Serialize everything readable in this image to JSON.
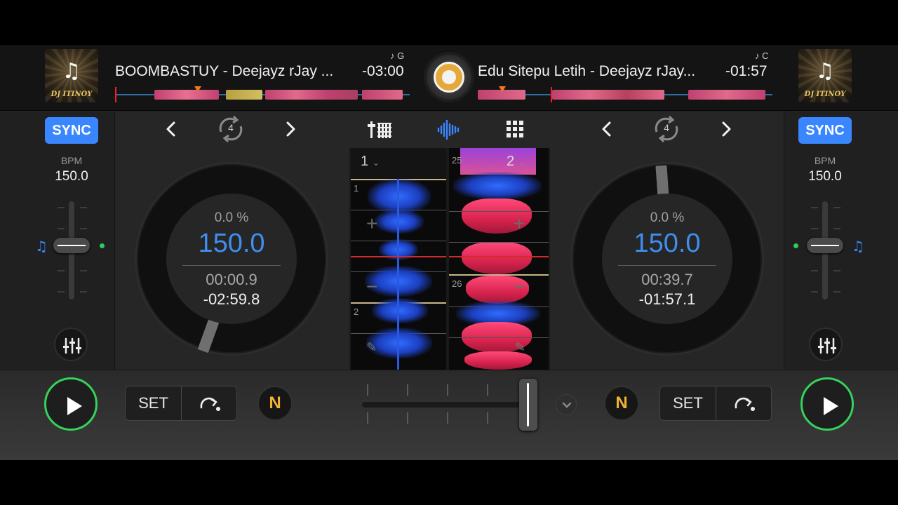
{
  "deck_a": {
    "title": "BOOMBASTUY - Deejayz rJay ...",
    "time_remaining": "-03:00",
    "key": "♪ G",
    "art_text": "DJ ITINOY",
    "sync_label": "SYNC",
    "bpm_label": "BPM",
    "bpm_value": "150.0",
    "loop_size": "4",
    "pitch_percent": "0.0 %",
    "bpm_big": "150.0",
    "elapsed": "00:00.9",
    "remaining": "-02:59.8",
    "set_label": "SET"
  },
  "deck_b": {
    "title": "Edu Sitepu Letih - Deejayz rJay...",
    "time_remaining": "-01:57",
    "key": "♪ C",
    "art_text": "DJ ITINOY",
    "sync_label": "SYNC",
    "bpm_label": "BPM",
    "bpm_value": "150.0",
    "loop_size": "4",
    "pitch_percent": "0.0 %",
    "bpm_big": "150.0",
    "elapsed": "00:39.7",
    "remaining": "-01:57.1",
    "set_label": "SET"
  },
  "center": {
    "deck_a_selector": "1",
    "deck_b_selector": "2",
    "wave_a_numbers": [
      "1",
      "2"
    ],
    "wave_b_numbers": [
      "25",
      "26"
    ],
    "plus": "+",
    "minus": "−"
  },
  "glyphs": {
    "note": "♫",
    "pencil": "✎",
    "n_logo": "N"
  },
  "colors": {
    "accent_blue": "#3a86ff",
    "play_green": "#35d25c",
    "bpm_blue": "#3f8ef0",
    "playhead_red": "#d12a2a",
    "cue_orange": "#f07a1a"
  },
  "crossfader": {
    "position": 0.93
  }
}
